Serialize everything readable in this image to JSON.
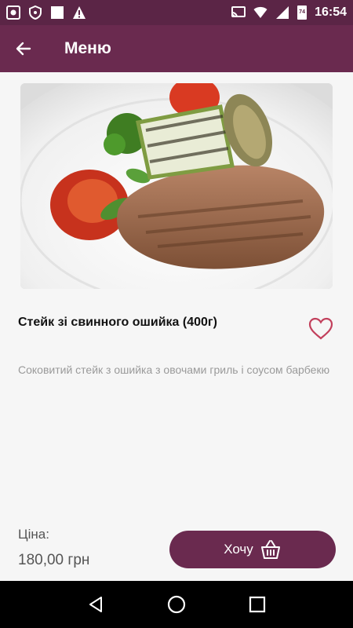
{
  "status_bar": {
    "time": "16:54",
    "battery": "74",
    "icons": [
      "screenshot-icon",
      "shield-icon",
      "square-icon",
      "warning-icon",
      "cast-icon",
      "wifi-icon",
      "signal-icon",
      "battery-icon"
    ]
  },
  "app_bar": {
    "title": "Меню",
    "back_icon": "arrow-left-icon"
  },
  "product": {
    "image_alt": "steak-photo",
    "title": "Стейк зі свинного ошийка  (400г)",
    "description": "Соковитий стейк  з  ошийка з овочами гриль і соусом барбекю",
    "favorite_icon": "heart-outline-icon",
    "price_label": "Ціна:",
    "price_value": "180,00 грн"
  },
  "action": {
    "want_label": "Хочу",
    "want_icon": "basket-icon"
  },
  "nav_bar": {
    "buttons": [
      "back-triangle-icon",
      "home-circle-icon",
      "recents-square-icon"
    ]
  },
  "colors": {
    "primary": "#6a2a4f",
    "status_bar": "#5b2546",
    "heart": "#c2405c",
    "text_muted": "#9a9a9a"
  }
}
